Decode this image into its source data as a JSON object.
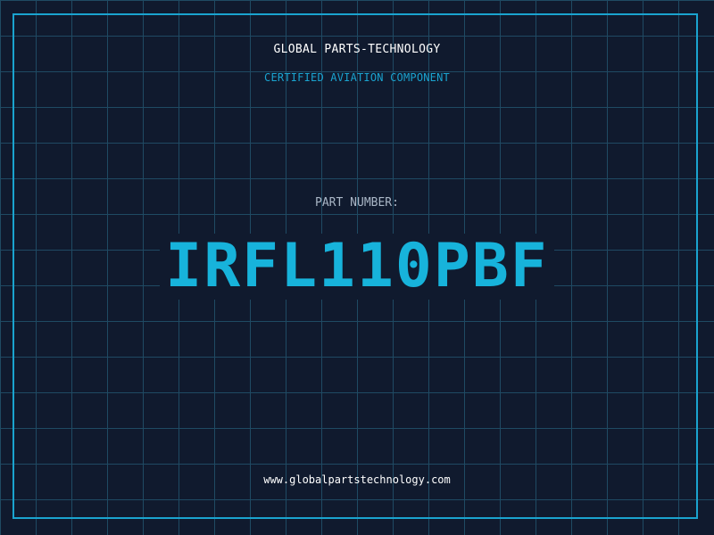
{
  "header": {
    "company": "GLOBAL PARTS-TECHNOLOGY",
    "tagline": "CERTIFIED AVIATION COMPONENT"
  },
  "part": {
    "label": "PART NUMBER:",
    "number": "IRFL110PBF"
  },
  "footer": {
    "url": "www.globalpartstechnology.com"
  },
  "colors": {
    "background": "#101a2e",
    "grid": "#1f4a63",
    "accent": "#1aa3cf",
    "part_number": "#17b3db"
  }
}
